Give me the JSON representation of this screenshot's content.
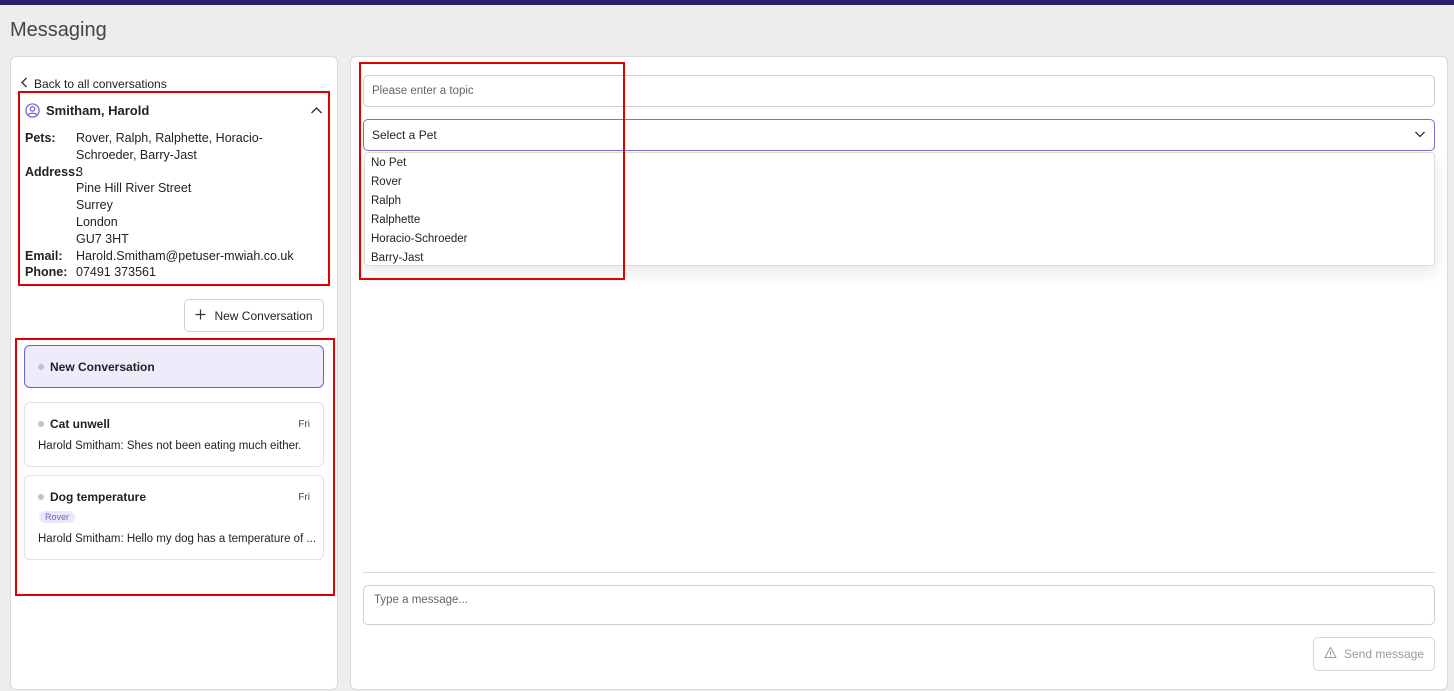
{
  "page": {
    "title": "Messaging"
  },
  "sidebar": {
    "back_label": "Back to all conversations",
    "client": {
      "name": "Smitham, Harold",
      "pets_label": "Pets:",
      "pets_line1": "Rover, Ralph, Ralphette, Horacio-",
      "pets_line2": "Schroeder, Barry-Jast",
      "address_label": "Address:",
      "address_lines": [
        "3",
        "Pine Hill River Street",
        "Surrey",
        "London",
        "GU7 3HT"
      ],
      "email_label": "Email:",
      "email": "Harold.Smitham@petuser-mwiah.co.uk",
      "phone_label": "Phone:",
      "phone": "07491 373561"
    },
    "new_conversation_label": "New Conversation",
    "conversations": [
      {
        "title": "New Conversation"
      },
      {
        "title": "Cat unwell",
        "day": "Fri",
        "preview": "Harold Smitham: Shes not been eating much either."
      },
      {
        "title": "Dog temperature",
        "day": "Fri",
        "tag": "Rover",
        "preview": "Harold Smitham: Hello my dog has a temperature of ..."
      }
    ]
  },
  "compose": {
    "topic_placeholder": "Please enter a topic",
    "pet_select": {
      "selected": "Select a Pet",
      "options": [
        "No Pet",
        "Rover",
        "Ralph",
        "Ralphette",
        "Horacio-Schroeder",
        "Barry-Jast"
      ]
    },
    "message_placeholder": "Type a message...",
    "send_label": "Send message"
  },
  "colors": {
    "accent": "#6b5fd1",
    "topbar": "#2d1f6b",
    "highlight_box": "#e00000",
    "active_card_bg": "#eeecfb"
  },
  "icons": [
    "chevron-left-icon",
    "user-circle-icon",
    "chevron-up-icon",
    "plus-icon",
    "chevron-down-icon",
    "warning-icon"
  ]
}
